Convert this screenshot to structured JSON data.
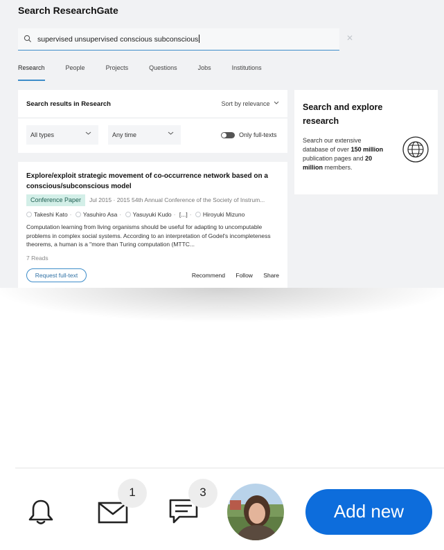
{
  "header": {
    "title": "Search ResearchGate"
  },
  "search": {
    "query": "supervised unsupervised conscious subconscious"
  },
  "tabs": [
    {
      "label": "Research"
    },
    {
      "label": "People"
    },
    {
      "label": "Projects"
    },
    {
      "label": "Questions"
    },
    {
      "label": "Jobs"
    },
    {
      "label": "Institutions"
    }
  ],
  "filters": {
    "title": "Search results in Research",
    "sort_label": "Sort by relevance",
    "type_value": "All types",
    "time_value": "Any time",
    "fulltext_label": "Only full-texts"
  },
  "result": {
    "title": "Explore/exploit strategic movement of co-occurrence network based on a conscious/subconscious model",
    "badge": "Conference Paper",
    "meta": "Jul 2015 · 2015 54th Annual Conference of the Society of Instrum...",
    "authors": [
      "Takeshi Kato",
      "Yasuhiro Asa",
      "Yasuyuki Kudo",
      "[...]",
      "Hiroyuki Mizuno"
    ],
    "abstract": "Computation learning from living organisms should be useful for adapting to uncomputable problems in complex social systems. According to an interpretation of Godel's incompleteness theorems, a human is a \"more than Turing computation (MTTC...",
    "reads": "7 Reads",
    "request_label": "Request full-text",
    "recommend_label": "Recommend",
    "follow_label": "Follow",
    "share_label": "Share"
  },
  "promo": {
    "title": "Search and explore research",
    "text_1": "Search our extensive database of over",
    "bold_1": "150 million",
    "text_2": "publication pages and",
    "bold_2": "20 million",
    "text_3": "members."
  },
  "bottom_nav": {
    "messages_count": "1",
    "chat_count": "3",
    "add_label": "Add new"
  },
  "colors": {
    "accent": "#3c8cc9",
    "badge_bg": "#d3efe8",
    "add_button": "#0d6ddc"
  }
}
